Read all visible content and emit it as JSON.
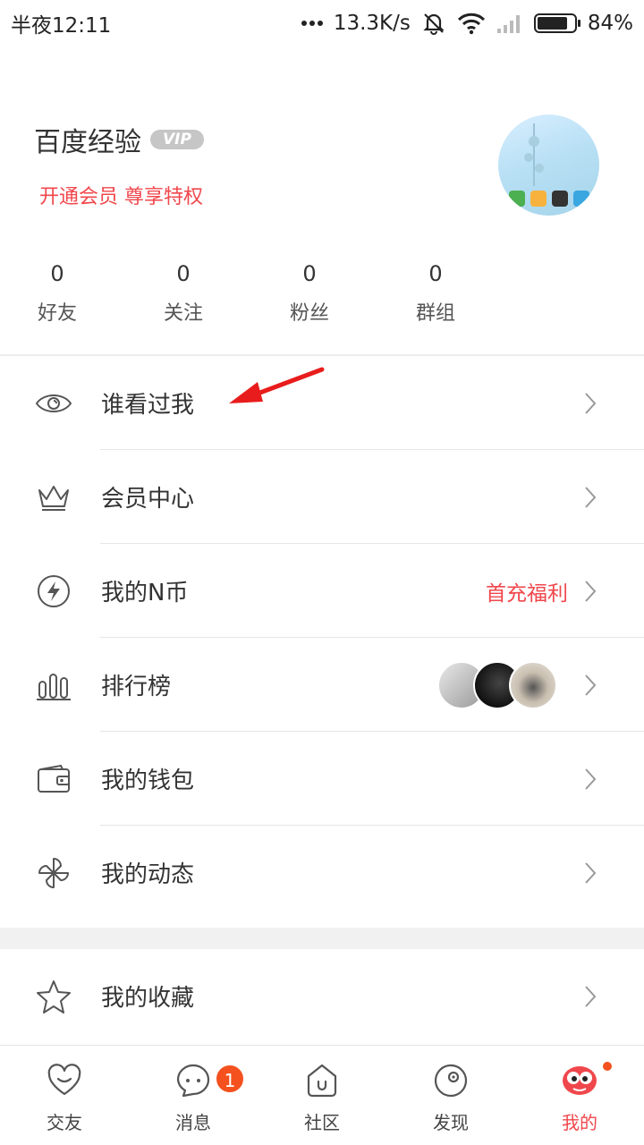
{
  "status_bar": {
    "time": "半夜12:11",
    "speed": "13.3K/s",
    "battery": "84%",
    "battery_level": 0.84
  },
  "profile": {
    "username": "百度经验",
    "vip_badge": "VIP",
    "vip_promo": "开通会员 尊享特权"
  },
  "stats": [
    {
      "value": "0",
      "label": "好友"
    },
    {
      "value": "0",
      "label": "关注"
    },
    {
      "value": "0",
      "label": "粉丝"
    },
    {
      "value": "0",
      "label": "群组"
    }
  ],
  "menu": [
    {
      "label": "谁看过我",
      "icon": "eye-icon"
    },
    {
      "label": "会员中心",
      "icon": "crown-icon"
    },
    {
      "label": "我的N币",
      "icon": "coin-icon",
      "extra": "首充福利"
    },
    {
      "label": "排行榜",
      "icon": "bar-chart-icon"
    },
    {
      "label": "我的钱包",
      "icon": "wallet-icon"
    },
    {
      "label": "我的动态",
      "icon": "pinwheel-icon"
    }
  ],
  "menu2": [
    {
      "label": "我的收藏",
      "icon": "star-icon"
    }
  ],
  "bottom_nav": [
    {
      "label": "交友",
      "icon": "heart-chat-icon"
    },
    {
      "label": "消息",
      "icon": "message-icon",
      "badge": "1"
    },
    {
      "label": "社区",
      "icon": "community-icon"
    },
    {
      "label": "发现",
      "icon": "discover-icon"
    },
    {
      "label": "我的",
      "icon": "me-icon",
      "active": true
    }
  ],
  "colors": {
    "accent": "#f0474c",
    "badge": "#f4511e",
    "icon": "#555555"
  }
}
